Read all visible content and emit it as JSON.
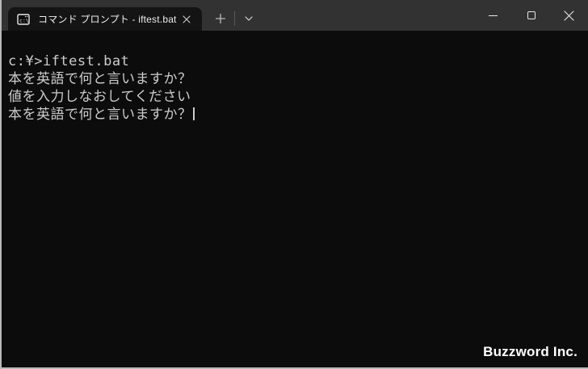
{
  "tab_bar": {
    "active_tab": {
      "title": "コマンド プロンプト - iftest.bat",
      "icon": "cmd-prompt-icon",
      "close_icon": "close-x"
    },
    "new_tab_icon": "plus",
    "dropdown_icon": "chevron-down"
  },
  "window_controls": {
    "minimize_icon": "minimize-dash",
    "maximize_icon": "maximize-square",
    "close_icon": "close-x"
  },
  "terminal": {
    "lines": [
      "c:¥>iftest.bat",
      "本を英語で何と言いますか？",
      "値を入力しなおしてください",
      "本を英語で何と言いますか？"
    ],
    "cursor_visible": true
  },
  "watermark": "Buzzword Inc.",
  "colors": {
    "titlebar_bg": "#323232",
    "tab_bg": "#141414",
    "terminal_bg": "#0c0c0c",
    "terminal_text": "#cccccc",
    "window_border": "#b9b9b9",
    "watermark_text": "#ffffff"
  }
}
